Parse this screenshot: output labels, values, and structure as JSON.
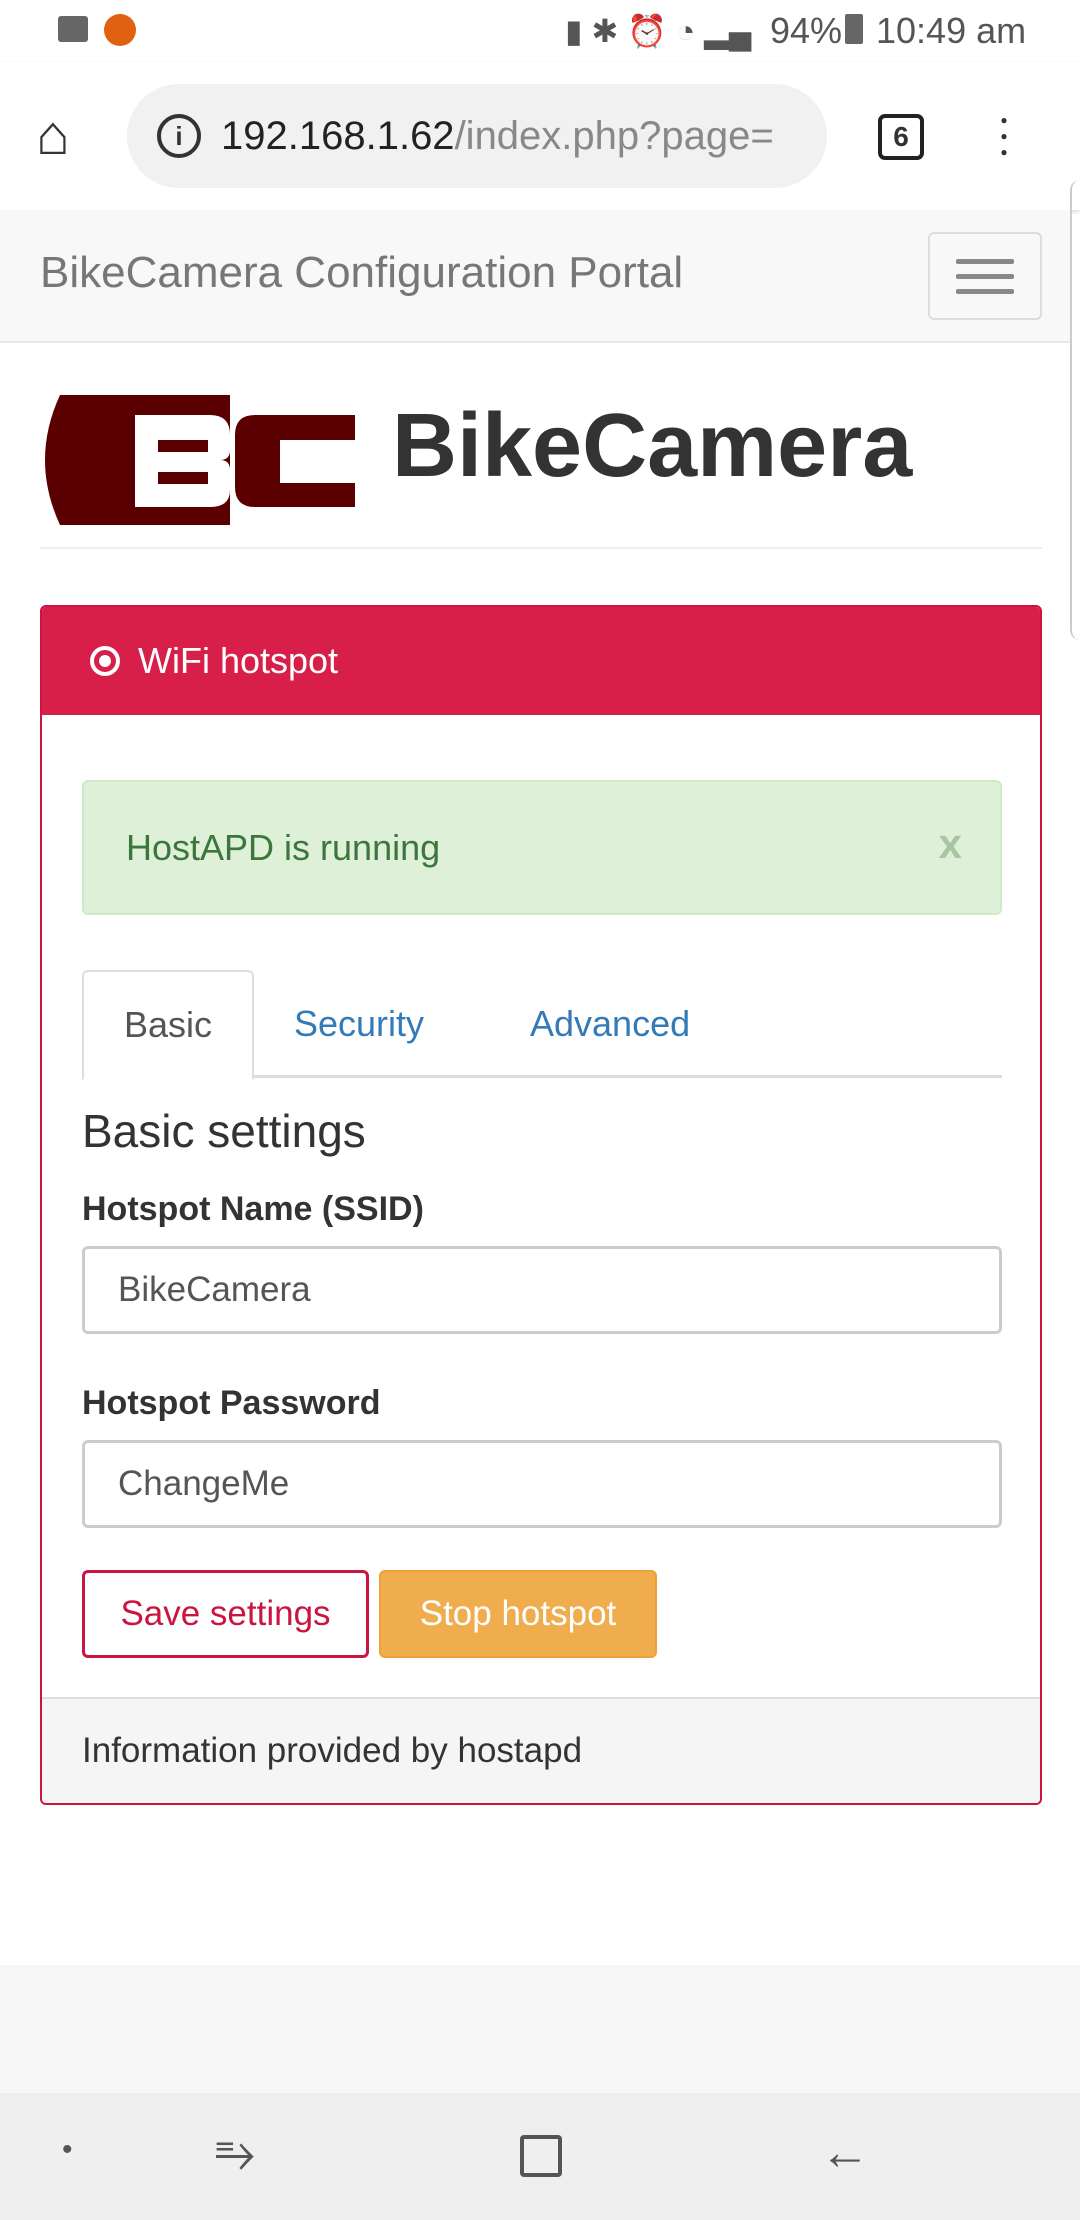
{
  "status": {
    "battery": "94%",
    "time": "10:49 am"
  },
  "browser": {
    "url_host": "192.168.1.62",
    "url_path": "/index.php?page=",
    "tab_count": "6"
  },
  "navbar": {
    "brand": "BikeCamera Configuration Portal"
  },
  "header": {
    "logo_text": "BC",
    "title": "BikeCamera"
  },
  "panel": {
    "heading": "WiFi hotspot",
    "alert": {
      "text": "HostAPD is running",
      "close": "x"
    },
    "tabs": [
      {
        "label": "Basic"
      },
      {
        "label": "Security"
      },
      {
        "label": "Advanced"
      }
    ],
    "section_title": "Basic settings",
    "fields": [
      {
        "label": "Hotspot Name (SSID)",
        "value": "BikeCamera"
      },
      {
        "label": "Hotspot Password",
        "value": "ChangeMe"
      }
    ],
    "buttons": {
      "save": "Save settings",
      "stop": "Stop hotspot"
    },
    "footer": "Information provided by hostapd"
  },
  "colors": {
    "accent": "#d81f4a",
    "logo": "#5a0000",
    "warning": "#f0ad4e",
    "success_bg": "#dff0d8"
  }
}
